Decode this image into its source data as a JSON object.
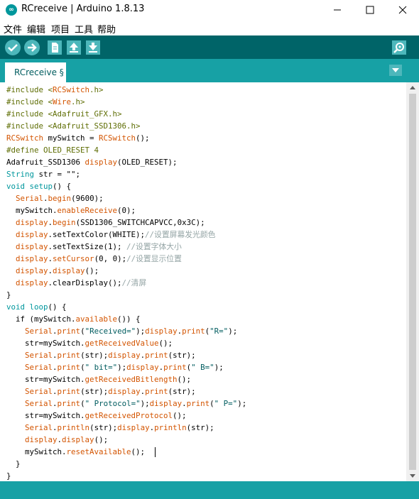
{
  "window": {
    "title": "RCreceive | Arduino 1.8.13",
    "logo_text": "∞"
  },
  "menu": [
    "文件",
    "编辑",
    "项目",
    "工具",
    "帮助"
  ],
  "toolbar": {
    "buttons": [
      "verify",
      "upload",
      "new",
      "open",
      "save"
    ],
    "serial_monitor": "serial-monitor"
  },
  "tab": {
    "label": "RCreceive §"
  },
  "code": [
    [
      [
        "#include <",
        "pre"
      ],
      [
        "RCSwitch",
        "kw"
      ],
      [
        ".h>",
        "pre"
      ]
    ],
    [
      [
        "#include <",
        "pre"
      ],
      [
        "Wire",
        "kw"
      ],
      [
        ".h>",
        "pre"
      ]
    ],
    [
      [
        "#include <Adafruit_GFX.h>",
        "pre"
      ]
    ],
    [
      [
        "#include <Adafruit_SSD1306.h>",
        "pre"
      ]
    ],
    [
      [
        "RCSwitch",
        "kw"
      ],
      [
        " mySwitch = ",
        ""
      ],
      [
        "RCSwitch",
        "kw"
      ],
      [
        "();",
        ""
      ]
    ],
    [
      [
        "#define OLED_RESET 4",
        "pre"
      ]
    ],
    [
      [
        "Adafruit_SSD1306 ",
        ""
      ],
      [
        "display",
        "kw"
      ],
      [
        "(OLED_RESET);",
        ""
      ]
    ],
    [
      [
        "String",
        "type"
      ],
      [
        " str = \"\";",
        ""
      ]
    ],
    [
      [
        "void",
        "type"
      ],
      [
        " ",
        ""
      ],
      [
        "setup",
        "type"
      ],
      [
        "() {",
        ""
      ]
    ],
    [
      [
        "  ",
        ""
      ],
      [
        "Serial",
        "kw"
      ],
      [
        ".",
        ""
      ],
      [
        "begin",
        "kw"
      ],
      [
        "(9600);",
        ""
      ]
    ],
    [
      [
        "  mySwitch.",
        ""
      ],
      [
        "enableReceive",
        "kw"
      ],
      [
        "(0);",
        ""
      ]
    ],
    [
      [
        "  ",
        ""
      ],
      [
        "display",
        "kw"
      ],
      [
        ".",
        ""
      ],
      [
        "begin",
        "kw"
      ],
      [
        "(SSD1306_SWITCHCAPVCC,0x3C);",
        ""
      ]
    ],
    [
      [
        "  ",
        ""
      ],
      [
        "display",
        "kw"
      ],
      [
        ".setTextColor(WHITE);",
        ""
      ],
      [
        "//设置屏幕发光颜色",
        ""
      ]
    ],
    [
      [
        "  ",
        ""
      ],
      [
        "display",
        "kw"
      ],
      [
        ".setTextSize(1); ",
        ""
      ],
      [
        "//设置字体大小",
        ""
      ]
    ],
    [
      [
        "  ",
        ""
      ],
      [
        "display",
        "kw"
      ],
      [
        ".",
        ""
      ],
      [
        "setCursor",
        "kw"
      ],
      [
        "(0, 0);",
        ""
      ],
      [
        "//设置显示位置",
        ""
      ]
    ],
    [
      [
        "  ",
        ""
      ],
      [
        "display",
        "kw"
      ],
      [
        ".",
        ""
      ],
      [
        "display",
        "kw"
      ],
      [
        "();",
        ""
      ]
    ],
    [
      [
        "  ",
        ""
      ],
      [
        "display",
        "kw"
      ],
      [
        ".clearDisplay();",
        ""
      ],
      [
        "//清屏",
        ""
      ]
    ],
    [
      [
        "}",
        ""
      ]
    ],
    [
      [
        "void",
        "type"
      ],
      [
        " ",
        ""
      ],
      [
        "loop",
        "type"
      ],
      [
        "() {",
        ""
      ]
    ],
    [
      [
        "  if (mySwitch.",
        ""
      ],
      [
        "available",
        "kw"
      ],
      [
        "()) {",
        ""
      ]
    ],
    [
      [
        "    ",
        ""
      ],
      [
        "Serial",
        "kw"
      ],
      [
        ".",
        ""
      ],
      [
        "print",
        "kw"
      ],
      [
        "(",
        ""
      ],
      [
        "\"Received=\"",
        "str"
      ],
      [
        ");",
        ""
      ],
      [
        "display",
        "kw"
      ],
      [
        ".",
        ""
      ],
      [
        "print",
        "kw"
      ],
      [
        "(",
        ""
      ],
      [
        "\"R=\"",
        "str"
      ],
      [
        ");",
        ""
      ]
    ],
    [
      [
        "    str=mySwitch.",
        ""
      ],
      [
        "getReceivedValue",
        "kw"
      ],
      [
        "();",
        ""
      ]
    ],
    [
      [
        "    ",
        ""
      ],
      [
        "Serial",
        "kw"
      ],
      [
        ".",
        ""
      ],
      [
        "print",
        "kw"
      ],
      [
        "(str);",
        ""
      ],
      [
        "display",
        "kw"
      ],
      [
        ".",
        ""
      ],
      [
        "print",
        "kw"
      ],
      [
        "(str);",
        ""
      ]
    ],
    [
      [
        "    ",
        ""
      ],
      [
        "Serial",
        "kw"
      ],
      [
        ".",
        ""
      ],
      [
        "print",
        "kw"
      ],
      [
        "(",
        ""
      ],
      [
        "\" bit=\"",
        "str"
      ],
      [
        ");",
        ""
      ],
      [
        "display",
        "kw"
      ],
      [
        ".",
        ""
      ],
      [
        "print",
        "kw"
      ],
      [
        "(",
        ""
      ],
      [
        "\" B=\"",
        "str"
      ],
      [
        ");",
        ""
      ]
    ],
    [
      [
        "    str=mySwitch.",
        ""
      ],
      [
        "getReceivedBitlength",
        "kw"
      ],
      [
        "();",
        ""
      ]
    ],
    [
      [
        "    ",
        ""
      ],
      [
        "Serial",
        "kw"
      ],
      [
        ".",
        ""
      ],
      [
        "print",
        "kw"
      ],
      [
        "(str);",
        ""
      ],
      [
        "display",
        "kw"
      ],
      [
        ".",
        ""
      ],
      [
        "print",
        "kw"
      ],
      [
        "(str);",
        ""
      ]
    ],
    [
      [
        "    ",
        ""
      ],
      [
        "Serial",
        "kw"
      ],
      [
        ".",
        ""
      ],
      [
        "print",
        "kw"
      ],
      [
        "(",
        ""
      ],
      [
        "\" Protocol=\"",
        "str"
      ],
      [
        ");",
        ""
      ],
      [
        "display",
        "kw"
      ],
      [
        ".",
        ""
      ],
      [
        "print",
        "kw"
      ],
      [
        "(",
        ""
      ],
      [
        "\" P=\"",
        "str"
      ],
      [
        ");",
        ""
      ]
    ],
    [
      [
        "    str=mySwitch.",
        ""
      ],
      [
        "getReceivedProtocol",
        "kw"
      ],
      [
        "();",
        ""
      ]
    ],
    [
      [
        "    ",
        ""
      ],
      [
        "Serial",
        "kw"
      ],
      [
        ".",
        ""
      ],
      [
        "println",
        "kw"
      ],
      [
        "(str);",
        ""
      ],
      [
        "display",
        "kw"
      ],
      [
        ".",
        ""
      ],
      [
        "println",
        "kw"
      ],
      [
        "(str);",
        ""
      ]
    ],
    [
      [
        "    ",
        ""
      ],
      [
        "display",
        "kw"
      ],
      [
        ".",
        ""
      ],
      [
        "display",
        "kw"
      ],
      [
        "();",
        ""
      ]
    ],
    [
      [
        "    mySwitch.",
        ""
      ],
      [
        "resetAvailable",
        "kw"
      ],
      [
        "();",
        ""
      ]
    ],
    [
      [
        "  }",
        ""
      ]
    ],
    [
      [
        "}",
        ""
      ]
    ]
  ],
  "colors": {
    "toolbar": "#006468",
    "tabbar": "#17a1a5",
    "keyword": "#d35400",
    "type": "#00979d"
  }
}
